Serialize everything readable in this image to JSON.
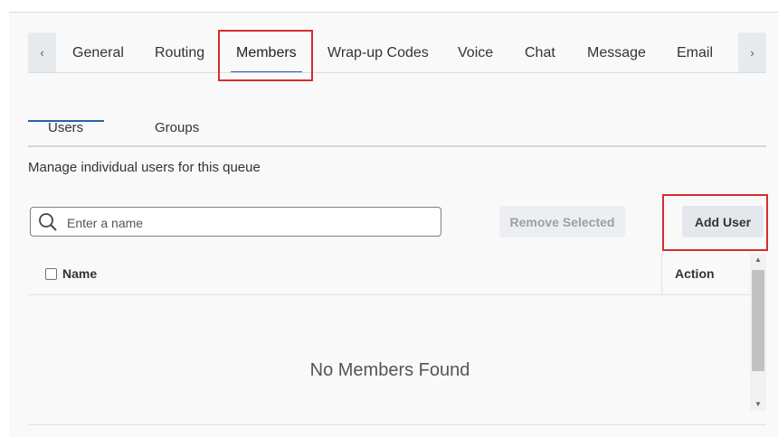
{
  "tabs": {
    "items": [
      {
        "label": "General"
      },
      {
        "label": "Routing"
      },
      {
        "label": "Members"
      },
      {
        "label": "Wrap-up Codes"
      },
      {
        "label": "Voice"
      },
      {
        "label": "Chat"
      },
      {
        "label": "Message"
      },
      {
        "label": "Email"
      }
    ],
    "active": "Members",
    "scroll_left_icon": "chevron-left-icon",
    "scroll_right_icon": "chevron-right-icon",
    "left_glyph": "‹",
    "right_glyph": "›"
  },
  "subtabs": {
    "items": [
      {
        "label": "Users"
      },
      {
        "label": "Groups"
      }
    ],
    "active": "Users"
  },
  "description": "Manage individual users for this queue",
  "search": {
    "placeholder": "Enter a name",
    "value": "",
    "icon": "search-icon"
  },
  "buttons": {
    "remove_selected": "Remove Selected",
    "add_user": "Add User"
  },
  "table": {
    "columns": [
      "Name",
      "Action"
    ],
    "empty_message": "No Members Found"
  },
  "scrollbar": {
    "up_glyph": "▲",
    "down_glyph": "▼"
  },
  "colors": {
    "accent": "#2a60a8",
    "highlight": "#d42e2e"
  }
}
